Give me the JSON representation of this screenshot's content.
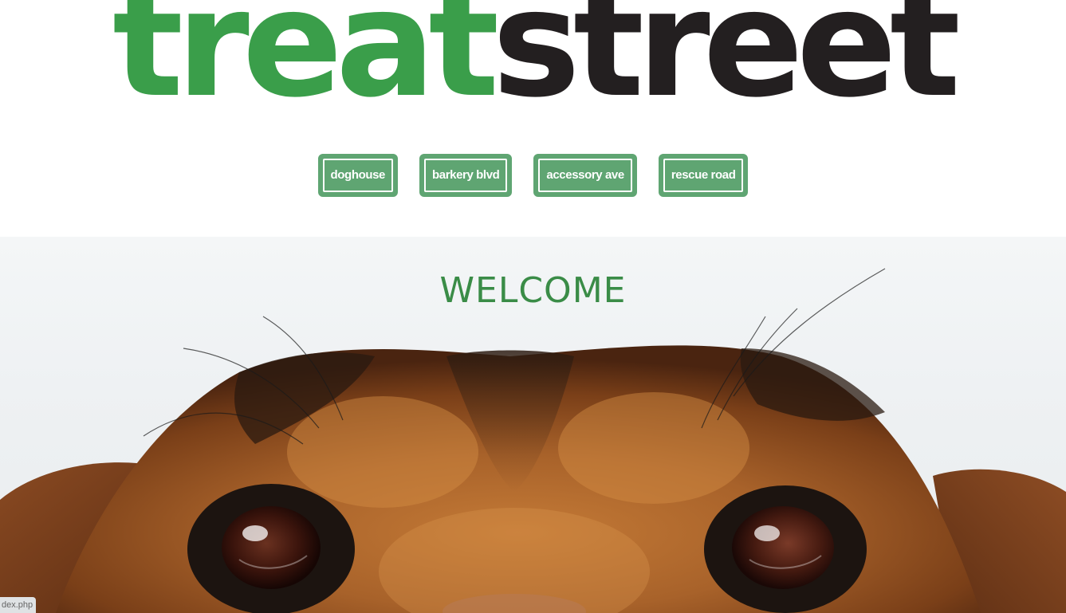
{
  "brand": {
    "part_a": "treat",
    "part_b": "street",
    "color_a": "#3a9e4a",
    "color_b": "#231f20"
  },
  "nav": {
    "items": [
      {
        "label": "doghouse"
      },
      {
        "label": "barkery blvd"
      },
      {
        "label": "accessory ave"
      },
      {
        "label": "rescue road"
      }
    ],
    "button_color": "#5fa572"
  },
  "hero": {
    "title": "WELCOME",
    "title_color": "#3a8c47",
    "image": "dog-face-photo"
  },
  "status_bar": {
    "url": "dex.php"
  }
}
